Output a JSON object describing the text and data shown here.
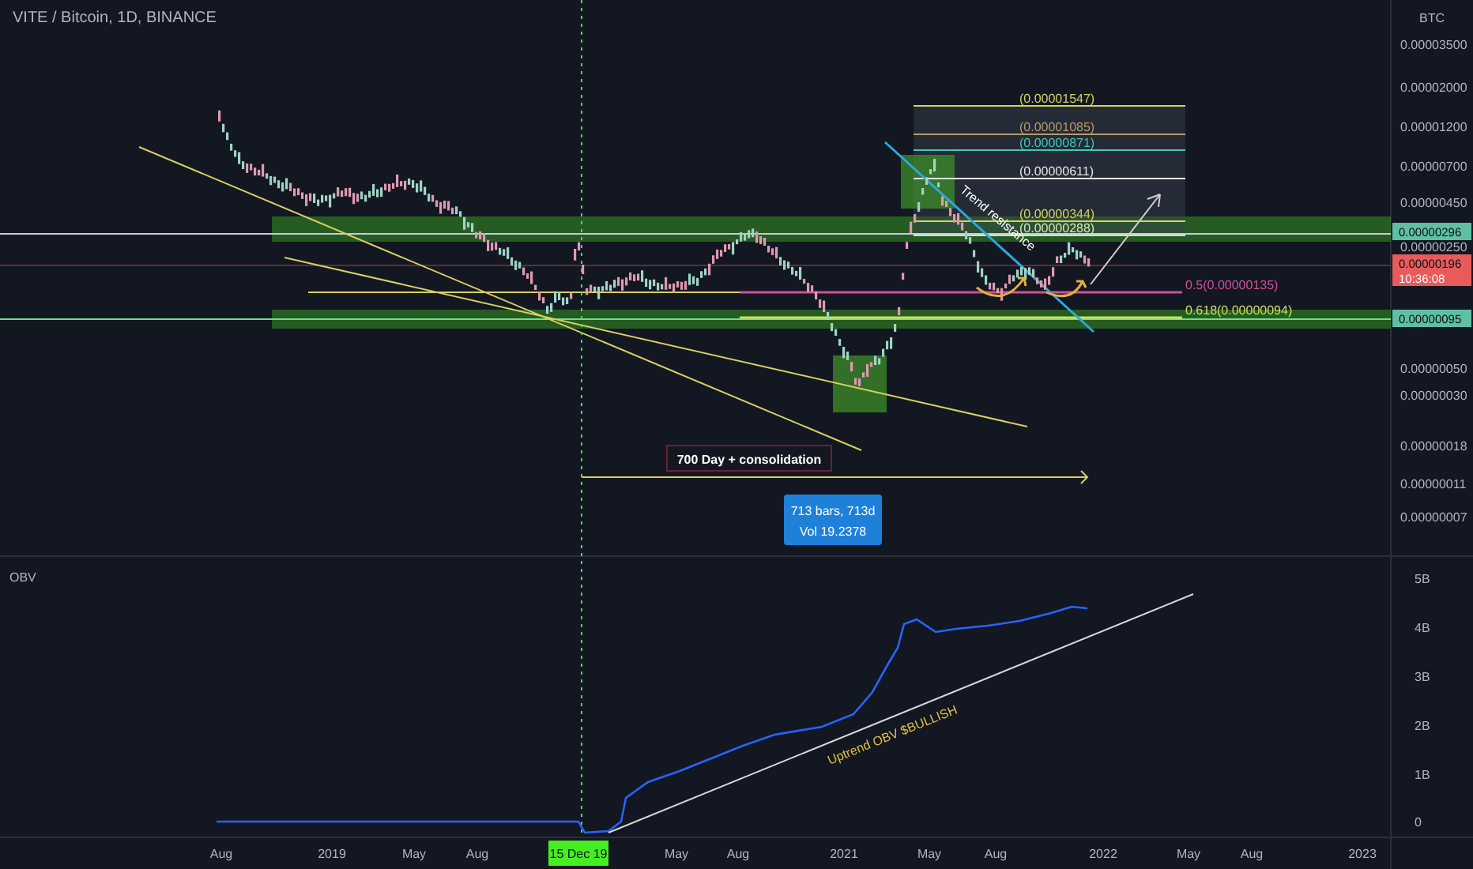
{
  "chart": {
    "title": "VITE / Bitcoin, 1D, BINANCE"
  },
  "price_axis": {
    "unit": "BTC",
    "labels": [
      "0.00003500",
      "0.00002000",
      "0.00001200",
      "0.00000700",
      "0.00000450",
      "0.00000250",
      "0.00000050",
      "0.00000030",
      "0.00000018",
      "0.00000011",
      "0.00000007"
    ]
  },
  "price_tags": [
    {
      "value": "0.00000296",
      "color": "#5fbfa4"
    },
    {
      "value": "0.00000196",
      "time": "10:36:08",
      "color": "#e85b5b"
    },
    {
      "value": "0.00000095",
      "color": "#5fbfa4"
    }
  ],
  "fib_levels": [
    {
      "label": "(0.00001547)",
      "color": "#d4d45a"
    },
    {
      "label": "(0.00001085)",
      "color": "#b89a6a"
    },
    {
      "label": "(0.00000871)",
      "color": "#3fc8b8"
    },
    {
      "label": "(0.00000611)",
      "color": "#e6e6e6"
    },
    {
      "label": "(0.00000344)",
      "color": "#d4d45a"
    },
    {
      "label": "(0.00000288)",
      "color": "#cfe8b0"
    }
  ],
  "retracements": [
    {
      "label": "0.5(0.00000135)",
      "color": "#d0509a"
    },
    {
      "label": "0.618(0.00000094)",
      "color": "#c8e05a"
    }
  ],
  "annotations": {
    "trend": "Trend resistance",
    "consolidation": "700 Day + consolidation",
    "obv_note": "Uptrend OBV $BULLISH"
  },
  "measure": {
    "bars": "713 bars, 713d",
    "volume": "Vol 19.2378"
  },
  "obv": {
    "title": "OBV",
    "labels": [
      "5B",
      "4B",
      "3B",
      "2B",
      "1B",
      "0"
    ]
  },
  "time_axis": {
    "labels": [
      {
        "text": "Aug",
        "selected": false
      },
      {
        "text": "2019",
        "selected": false
      },
      {
        "text": "May",
        "selected": false
      },
      {
        "text": "Aug",
        "selected": false
      },
      {
        "text": "15 Dec 19",
        "selected": true
      },
      {
        "text": "May",
        "selected": false
      },
      {
        "text": "Aug",
        "selected": false
      },
      {
        "text": "2021",
        "selected": false
      },
      {
        "text": "May",
        "selected": false
      },
      {
        "text": "Aug",
        "selected": false
      },
      {
        "text": "2022",
        "selected": false
      },
      {
        "text": "May",
        "selected": false
      },
      {
        "text": "Aug",
        "selected": false
      },
      {
        "text": "2023",
        "selected": false
      }
    ]
  }
}
